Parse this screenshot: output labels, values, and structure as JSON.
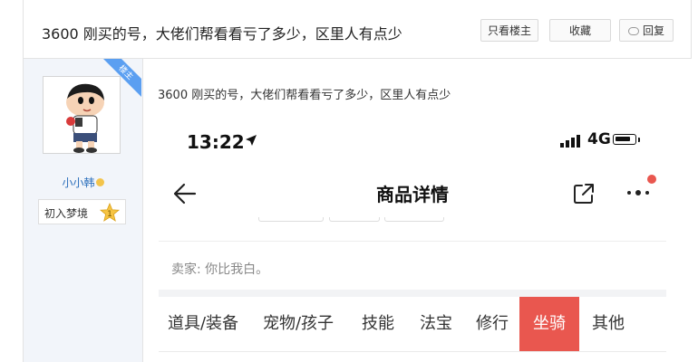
{
  "thread": {
    "title": "3600 刚买的号，大佬们帮看看亏了多少，区里人有点少",
    "buttons": {
      "only_op": "只看楼主",
      "favorite": "收藏",
      "reply": "回复"
    }
  },
  "author": {
    "badge": "楼主",
    "name": "小小韩",
    "rank": "初入梦境",
    "rank_number": "1"
  },
  "post": {
    "text": "3600 刚买的号，大佬们帮看看亏了多少，区里人有点少"
  },
  "phone": {
    "time": "13:22",
    "network": "4G",
    "nav_title": "商品详情",
    "seller_line": "卖家: 你比我白。",
    "tabs": [
      "道具/装备",
      "宠物/孩子",
      "技能",
      "法宝",
      "修行",
      "坐骑",
      "其他"
    ],
    "active_tab_index": 5,
    "accent_color": "#e9574f"
  },
  "colors": {
    "link": "#2a6ebb",
    "ribbon": "#5b9ff1",
    "panel": "#f2f5fa"
  }
}
